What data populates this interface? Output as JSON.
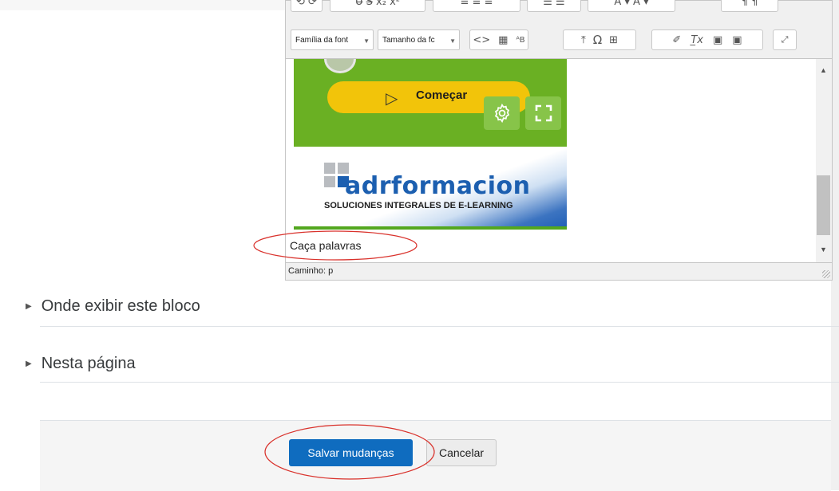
{
  "editor": {
    "toolbar": {
      "font_family_label": "Família da font",
      "font_size_label": "Tamanho da fc",
      "buttons": [
        "source-code",
        "find",
        "find-replace",
        "insert",
        "special-char",
        "table",
        "clear",
        "remove-format",
        "paste-text",
        "paste-word",
        "fullscreen"
      ]
    },
    "content": {
      "start_label": "Começar",
      "logo_text": "adrformacion",
      "tagline": "SOLUCIONES INTEGRALES DE E-LEARNING",
      "caption": "Caça palavras"
    },
    "status_path": "Caminho: p"
  },
  "sections": {
    "display_location": "Onde exibir este bloco",
    "this_page": "Nesta página"
  },
  "footer": {
    "save_label": "Salvar mudanças",
    "cancel_label": "Cancelar"
  },
  "colors": {
    "primary": "#0f6cbf",
    "annotation": "#d9312b",
    "game_green": "#6ab023",
    "start_yellow": "#f2c40a"
  }
}
